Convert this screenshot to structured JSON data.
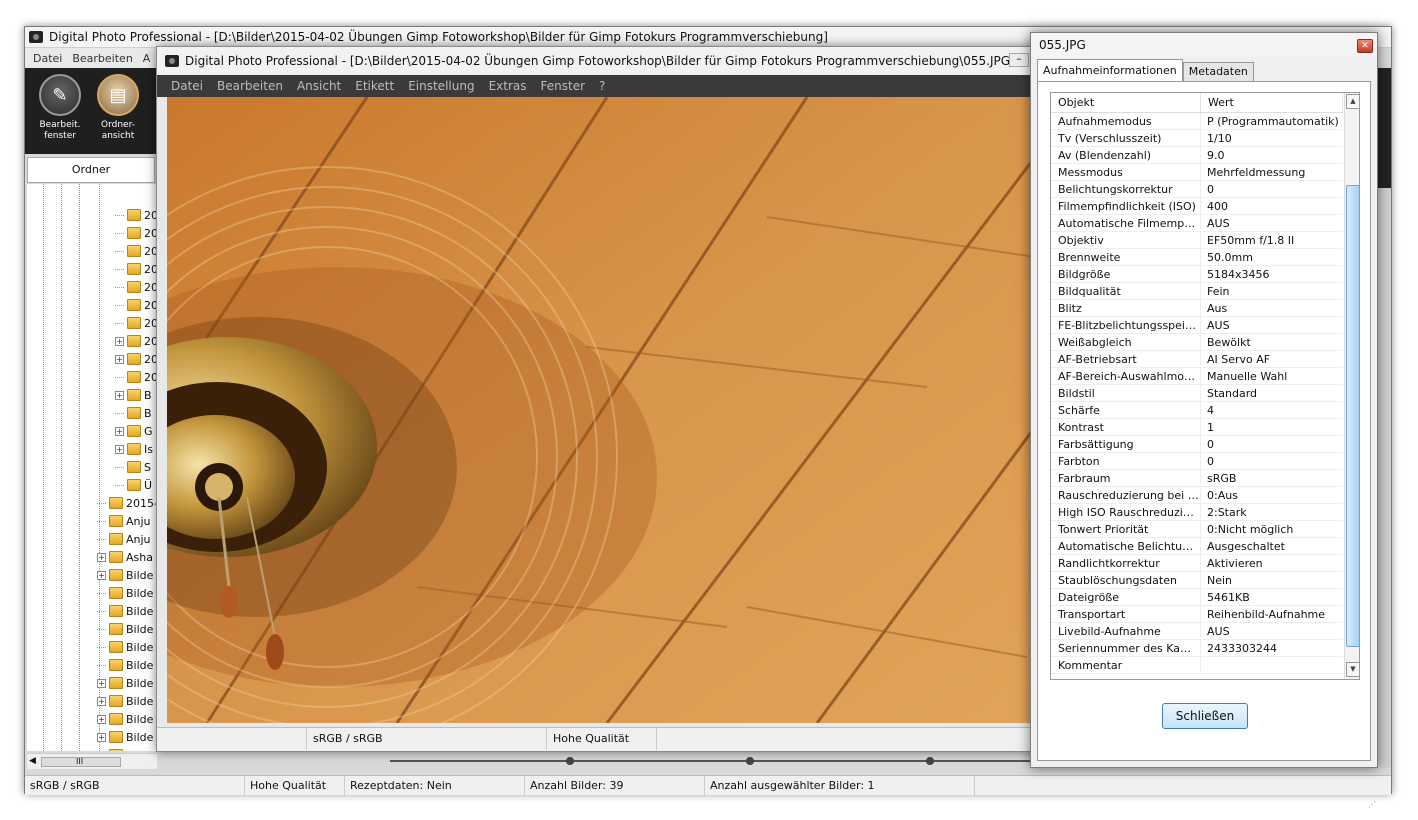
{
  "main": {
    "title": "Digital Photo Professional - [D:\\Bilder\\2015-04-02 Übungen  Gimp Fotoworkshop\\Bilder für Gimp Fotokurs Programmverschiebung]",
    "menu": [
      "Datei",
      "Bearbeiten",
      "A"
    ],
    "toolbar": {
      "edit_window": "Bearbeit. fenster",
      "folder_view": "Ordner- ansicht"
    },
    "folder_tab": "Ordner",
    "tree": [
      {
        "label": "20",
        "indent": 5,
        "expand": false
      },
      {
        "label": "20",
        "indent": 5,
        "expand": false
      },
      {
        "label": "20",
        "indent": 5,
        "expand": false
      },
      {
        "label": "20",
        "indent": 5,
        "expand": false
      },
      {
        "label": "20",
        "indent": 5,
        "expand": false
      },
      {
        "label": "20",
        "indent": 5,
        "expand": false
      },
      {
        "label": "20",
        "indent": 5,
        "expand": false
      },
      {
        "label": "20",
        "indent": 5,
        "expand": true
      },
      {
        "label": "20",
        "indent": 5,
        "expand": true
      },
      {
        "label": "20",
        "indent": 5,
        "expand": false
      },
      {
        "label": "B",
        "indent": 5,
        "expand": true
      },
      {
        "label": "B",
        "indent": 5,
        "expand": false
      },
      {
        "label": "G",
        "indent": 5,
        "expand": true
      },
      {
        "label": "Is",
        "indent": 5,
        "expand": true
      },
      {
        "label": "S",
        "indent": 5,
        "expand": false
      },
      {
        "label": "Ü",
        "indent": 5,
        "expand": false
      },
      {
        "label": "2015-",
        "indent": 4,
        "expand": false
      },
      {
        "label": "Anju",
        "indent": 4,
        "expand": false
      },
      {
        "label": "Anju",
        "indent": 4,
        "expand": false
      },
      {
        "label": "Asha",
        "indent": 4,
        "expand": true
      },
      {
        "label": "Bilde",
        "indent": 4,
        "expand": true
      },
      {
        "label": "Bilde",
        "indent": 4,
        "expand": false
      },
      {
        "label": "Bilde",
        "indent": 4,
        "expand": false
      },
      {
        "label": "Bilde",
        "indent": 4,
        "expand": false
      },
      {
        "label": "Bilde",
        "indent": 4,
        "expand": false
      },
      {
        "label": "Bilde",
        "indent": 4,
        "expand": false
      },
      {
        "label": "Bilde",
        "indent": 4,
        "expand": true
      },
      {
        "label": "Bilde",
        "indent": 4,
        "expand": true
      },
      {
        "label": "Bilde",
        "indent": 4,
        "expand": true
      },
      {
        "label": "Bilde",
        "indent": 4,
        "expand": true
      },
      {
        "label": "Bilde",
        "indent": 4,
        "expand": true
      }
    ],
    "hscroll_label": "III",
    "status": [
      "sRGB / sRGB",
      "Hohe Qualität",
      "Rezeptdaten: Nein",
      "Anzahl Bilder: 39",
      "Anzahl ausgewählter Bilder: 1"
    ]
  },
  "editor": {
    "title": "Digital Photo Professional - [D:\\Bilder\\2015-04-02 Übungen  Gimp Fotoworkshop\\Bilder für Gimp Fotokurs Programmverschiebung\\055.JPG]",
    "menu": [
      "Datei",
      "Bearbeiten",
      "Ansicht",
      "Etikett",
      "Einstellung",
      "Extras",
      "Fenster",
      "?"
    ],
    "status": [
      "sRGB / sRGB",
      "Hohe Qualität"
    ]
  },
  "dialog": {
    "title": "055.JPG",
    "tabs": [
      "Aufnahmeinformationen",
      "Metadaten"
    ],
    "active_tab": 0,
    "columns": [
      "Objekt",
      "Wert"
    ],
    "rows": [
      [
        "Aufnahmemodus",
        "P (Programmautomatik)"
      ],
      [
        "Tv (Verschlusszeit)",
        "1/10"
      ],
      [
        "Av (Blendenzahl)",
        "9.0"
      ],
      [
        "Messmodus",
        "Mehrfeldmessung"
      ],
      [
        "Belichtungskorrektur",
        "0"
      ],
      [
        "Filmempfindlichkeit (ISO)",
        "400"
      ],
      [
        "Automatische Filmempfindli...",
        "AUS"
      ],
      [
        "Objektiv",
        "EF50mm f/1.8 II"
      ],
      [
        "Brennweite",
        "50.0mm"
      ],
      [
        "Bildgröße",
        "5184x3456"
      ],
      [
        "Bildqualität",
        "Fein"
      ],
      [
        "Blitz",
        "Aus"
      ],
      [
        "FE-Blitzbelichtungsspeicher...",
        "AUS"
      ],
      [
        "Weißabgleich",
        "Bewölkt"
      ],
      [
        "AF-Betriebsart",
        "AI Servo AF"
      ],
      [
        "AF-Bereich-Auswahlmodus",
        "Manuelle  Wahl"
      ],
      [
        "Bildstil",
        "Standard"
      ],
      [
        "Schärfe",
        "4"
      ],
      [
        "Kontrast",
        "1"
      ],
      [
        "Farbsättigung",
        "0"
      ],
      [
        "Farbton",
        "0"
      ],
      [
        "Farbraum",
        "sRGB"
      ],
      [
        "Rauschreduzierung bei Lan...",
        "0:Aus"
      ],
      [
        "High ISO Rauschreduzierung",
        "2:Stark"
      ],
      [
        "Tonwert Priorität",
        "0:Nicht möglich"
      ],
      [
        "Automatische Belichtungso...",
        "Ausgeschaltet"
      ],
      [
        "Randlichtkorrektur",
        "Aktivieren"
      ],
      [
        "Staublöschungsdaten",
        "Nein"
      ],
      [
        "Dateigröße",
        "5461KB"
      ],
      [
        "Transportart",
        "Reihenbild-Aufnahme"
      ],
      [
        "Livebild-Aufnahme",
        "AUS"
      ],
      [
        "Seriennummer des Kamera...",
        "2433303244"
      ],
      [
        "Kommentar",
        ""
      ]
    ],
    "close_button": "Schließen"
  },
  "icons": {
    "app": "camera-app-icon",
    "edit": "edit-window-icon",
    "folder": "folder-view-icon",
    "close": "close-icon",
    "folder_item": "folder-icon"
  },
  "colors": {
    "toolbar_bg": "#1f1f1f",
    "editor_menu_bg": "#3a3a3a",
    "photo_wood": "#c8843a",
    "close_btn": "#c43c28",
    "scroll_thumb": "#a8d0f2"
  }
}
